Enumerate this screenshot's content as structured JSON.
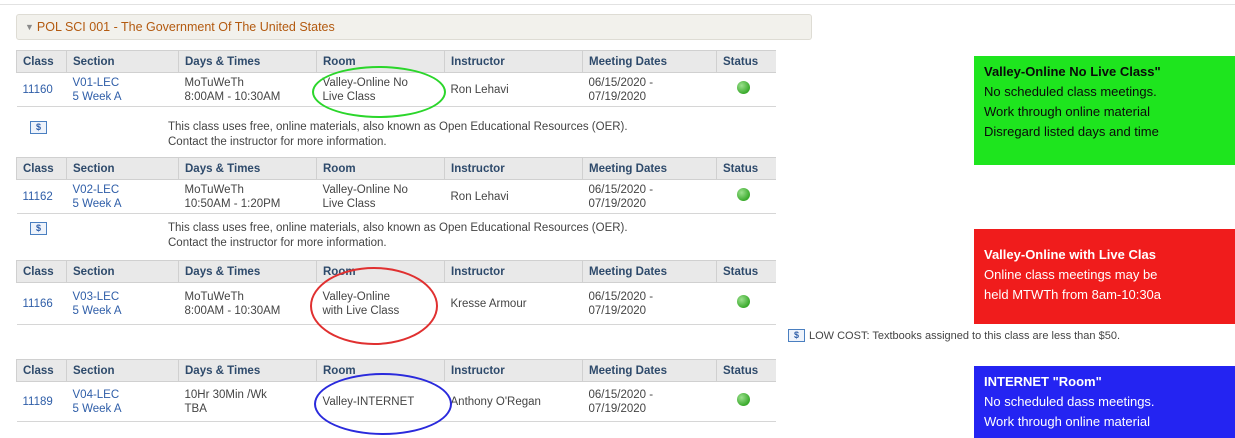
{
  "course": {
    "title": "POL SCI 001 - The Government Of The United States",
    "toggle_glyph": "▼"
  },
  "columns": [
    "Class",
    "Section",
    "Days & Times",
    "Room",
    "Instructor",
    "Meeting Dates",
    "Status"
  ],
  "sections": [
    {
      "class_nbr": "11160",
      "section_1": "V01-LEC",
      "section_2": "5 Week A",
      "days_1": "MoTuWeTh",
      "days_2": "8:00AM - 10:30AM",
      "room_1": "Valley-Online No",
      "room_2": "Live Class",
      "instructor": "Ron Lehavi",
      "dates_1": "06/15/2020 -",
      "dates_2": "07/19/2020",
      "status": "open",
      "note_1": "This class uses free, online materials, also known as Open Educational Resources (OER).",
      "note_2": "Contact the instructor for more information."
    },
    {
      "class_nbr": "11162",
      "section_1": "V02-LEC",
      "section_2": "5 Week A",
      "days_1": "MoTuWeTh",
      "days_2": "10:50AM - 1:20PM",
      "room_1": "Valley-Online No",
      "room_2": "Live Class",
      "instructor": "Ron Lehavi",
      "dates_1": "06/15/2020 -",
      "dates_2": "07/19/2020",
      "status": "open",
      "note_1": "This class uses free, online materials, also known as Open Educational Resources (OER).",
      "note_2": "Contact the instructor for more information."
    },
    {
      "class_nbr": "11166",
      "section_1": "V03-LEC",
      "section_2": "5 Week A",
      "days_1": "MoTuWeTh",
      "days_2": "8:00AM - 10:30AM",
      "room_1": "Valley-Online",
      "room_2": "with Live Class",
      "instructor": "Kresse Armour",
      "dates_1": "06/15/2020 -",
      "dates_2": "07/19/2020",
      "status": "open"
    },
    {
      "class_nbr": "11189",
      "section_1": "V04-LEC",
      "section_2": "5 Week A",
      "days_1": "10Hr 30Min /Wk",
      "days_2": "TBA",
      "room_1": "Valley-INTERNET",
      "room_2": "",
      "instructor": "Anthony O'Regan",
      "dates_1": "06/15/2020 -",
      "dates_2": "07/19/2020",
      "status": "open"
    }
  ],
  "oer_icon": "$",
  "low_cost": "LOW COST: Textbooks assigned to this class are less than $50.",
  "callouts": {
    "green": {
      "color": "#1ee51e",
      "title": "Valley-Online No Live Class\"",
      "line1": "No scheduled class meetings.",
      "line2": "Work through online material",
      "line3": "Disregard listed days and time"
    },
    "red": {
      "color": "#f01c1c",
      "title": "Valley-Online with Live Clas",
      "line1": "Online class meetings may be",
      "line2": "held MTWTh from 8am-10:30a"
    },
    "blue": {
      "color": "#2424f2",
      "title": "INTERNET \"Room\"",
      "line1": "No scheduled dass meetings.",
      "line2": "Work through online material"
    }
  },
  "highlight_colors": {
    "green": "#2bd62b",
    "red": "#e03030",
    "blue": "#2a2adc"
  }
}
